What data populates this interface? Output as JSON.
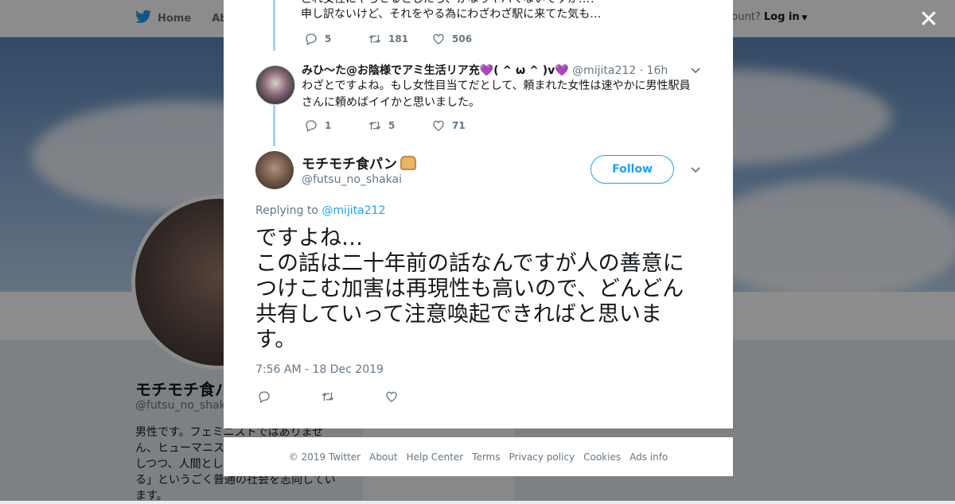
{
  "topbar": {
    "home_label": "Home",
    "about_label": "Abo",
    "account_prompt": "ccount?",
    "login_label": "Log in"
  },
  "profile": {
    "name": "モチモチ食パン",
    "handle": "@futsu_no_shakai",
    "bio": "男性です。フェミニストではありませ\nん、ヒューマニス\nしつつ、人間とし\nる」というごく普通の社会を志向してい\nます。",
    "side_ads_info": "Ads info"
  },
  "modal": {
    "prev_tweet": {
      "text_line1": "これ女性にやらせるとしたら、かなりヤバくないですか…？",
      "text_line2": "申し訳ないけど、それをやる為にわざわざ駅に来てた気も…",
      "replies": "5",
      "retweets": "181",
      "likes": "506"
    },
    "reply_tweet": {
      "name": "みひ～た@お陰様でアミ生活リア充",
      "name_deco": "( ^ ω ^ )v",
      "heart": "💜",
      "handle": "@mijita212",
      "time": "· 16h",
      "text": "わざとですよね。もし女性目当てだとして、頼まれた女性は速やかに男性駅員さんに頼めばイイかと思いました。",
      "replies": "1",
      "retweets": "5",
      "likes": "71"
    },
    "main_tweet": {
      "name": "モチモチ食パン",
      "handle": "@futsu_no_shakai",
      "follow_label": "Follow",
      "replying_prefix": "Replying to ",
      "replying_to": "@mijita212",
      "text": "ですよね…\nこの話は二十年前の話なんですが人の善意につけこむ加害は再現性も高いので、どんどん共有していって注意喚起できればと思います。",
      "timestamp": "7:56 AM - 18 Dec 2019"
    }
  },
  "footer": {
    "copyright": "© 2019 Twitter",
    "links": [
      "About",
      "Help Center",
      "Terms",
      "Privacy policy",
      "Cookies",
      "Ads info"
    ]
  },
  "colors": {
    "accent": "#1da1f2",
    "thread_line": "#a3d4f5",
    "muted": "#657786",
    "text": "#14171a"
  },
  "icons": [
    "twitter-bird-icon",
    "reply-icon",
    "retweet-icon",
    "like-icon",
    "caret-down-icon",
    "close-icon",
    "purple-heart-icon",
    "bread-icon"
  ]
}
